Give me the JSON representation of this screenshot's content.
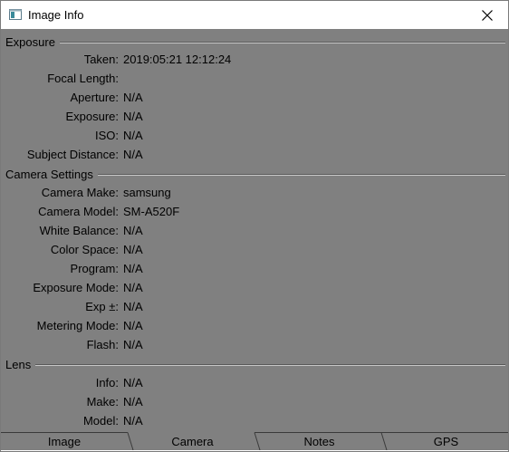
{
  "window": {
    "title": "Image Info"
  },
  "sections": {
    "exposure": {
      "label": "Exposure",
      "rows": [
        {
          "key": "Taken:",
          "value": "2019:05:21 12:12:24"
        },
        {
          "key": "Focal Length:",
          "value": ""
        },
        {
          "key": "Aperture:",
          "value": "N/A"
        },
        {
          "key": "Exposure:",
          "value": "N/A"
        },
        {
          "key": "ISO:",
          "value": "N/A"
        },
        {
          "key": "Subject Distance:",
          "value": "N/A"
        }
      ]
    },
    "camera": {
      "label": "Camera Settings",
      "rows": [
        {
          "key": "Camera Make:",
          "value": "samsung"
        },
        {
          "key": "Camera Model:",
          "value": "SM-A520F"
        },
        {
          "key": "White Balance:",
          "value": "N/A"
        },
        {
          "key": "Color Space:",
          "value": "N/A"
        },
        {
          "key": "Program:",
          "value": "N/A"
        },
        {
          "key": "Exposure Mode:",
          "value": "N/A"
        },
        {
          "key": "Exp ±:",
          "value": "N/A"
        },
        {
          "key": "Metering Mode:",
          "value": "N/A"
        },
        {
          "key": "Flash:",
          "value": "N/A"
        }
      ]
    },
    "lens": {
      "label": "Lens",
      "rows": [
        {
          "key": "Info:",
          "value": "N/A"
        },
        {
          "key": "Make:",
          "value": "N/A"
        },
        {
          "key": "Model:",
          "value": "N/A"
        }
      ]
    }
  },
  "tabs": [
    {
      "label": "Image",
      "active": false
    },
    {
      "label": "Camera",
      "active": true
    },
    {
      "label": "Notes",
      "active": false
    },
    {
      "label": "GPS",
      "active": false
    }
  ],
  "icons": {
    "app": "window-icon",
    "close": "close-icon"
  }
}
